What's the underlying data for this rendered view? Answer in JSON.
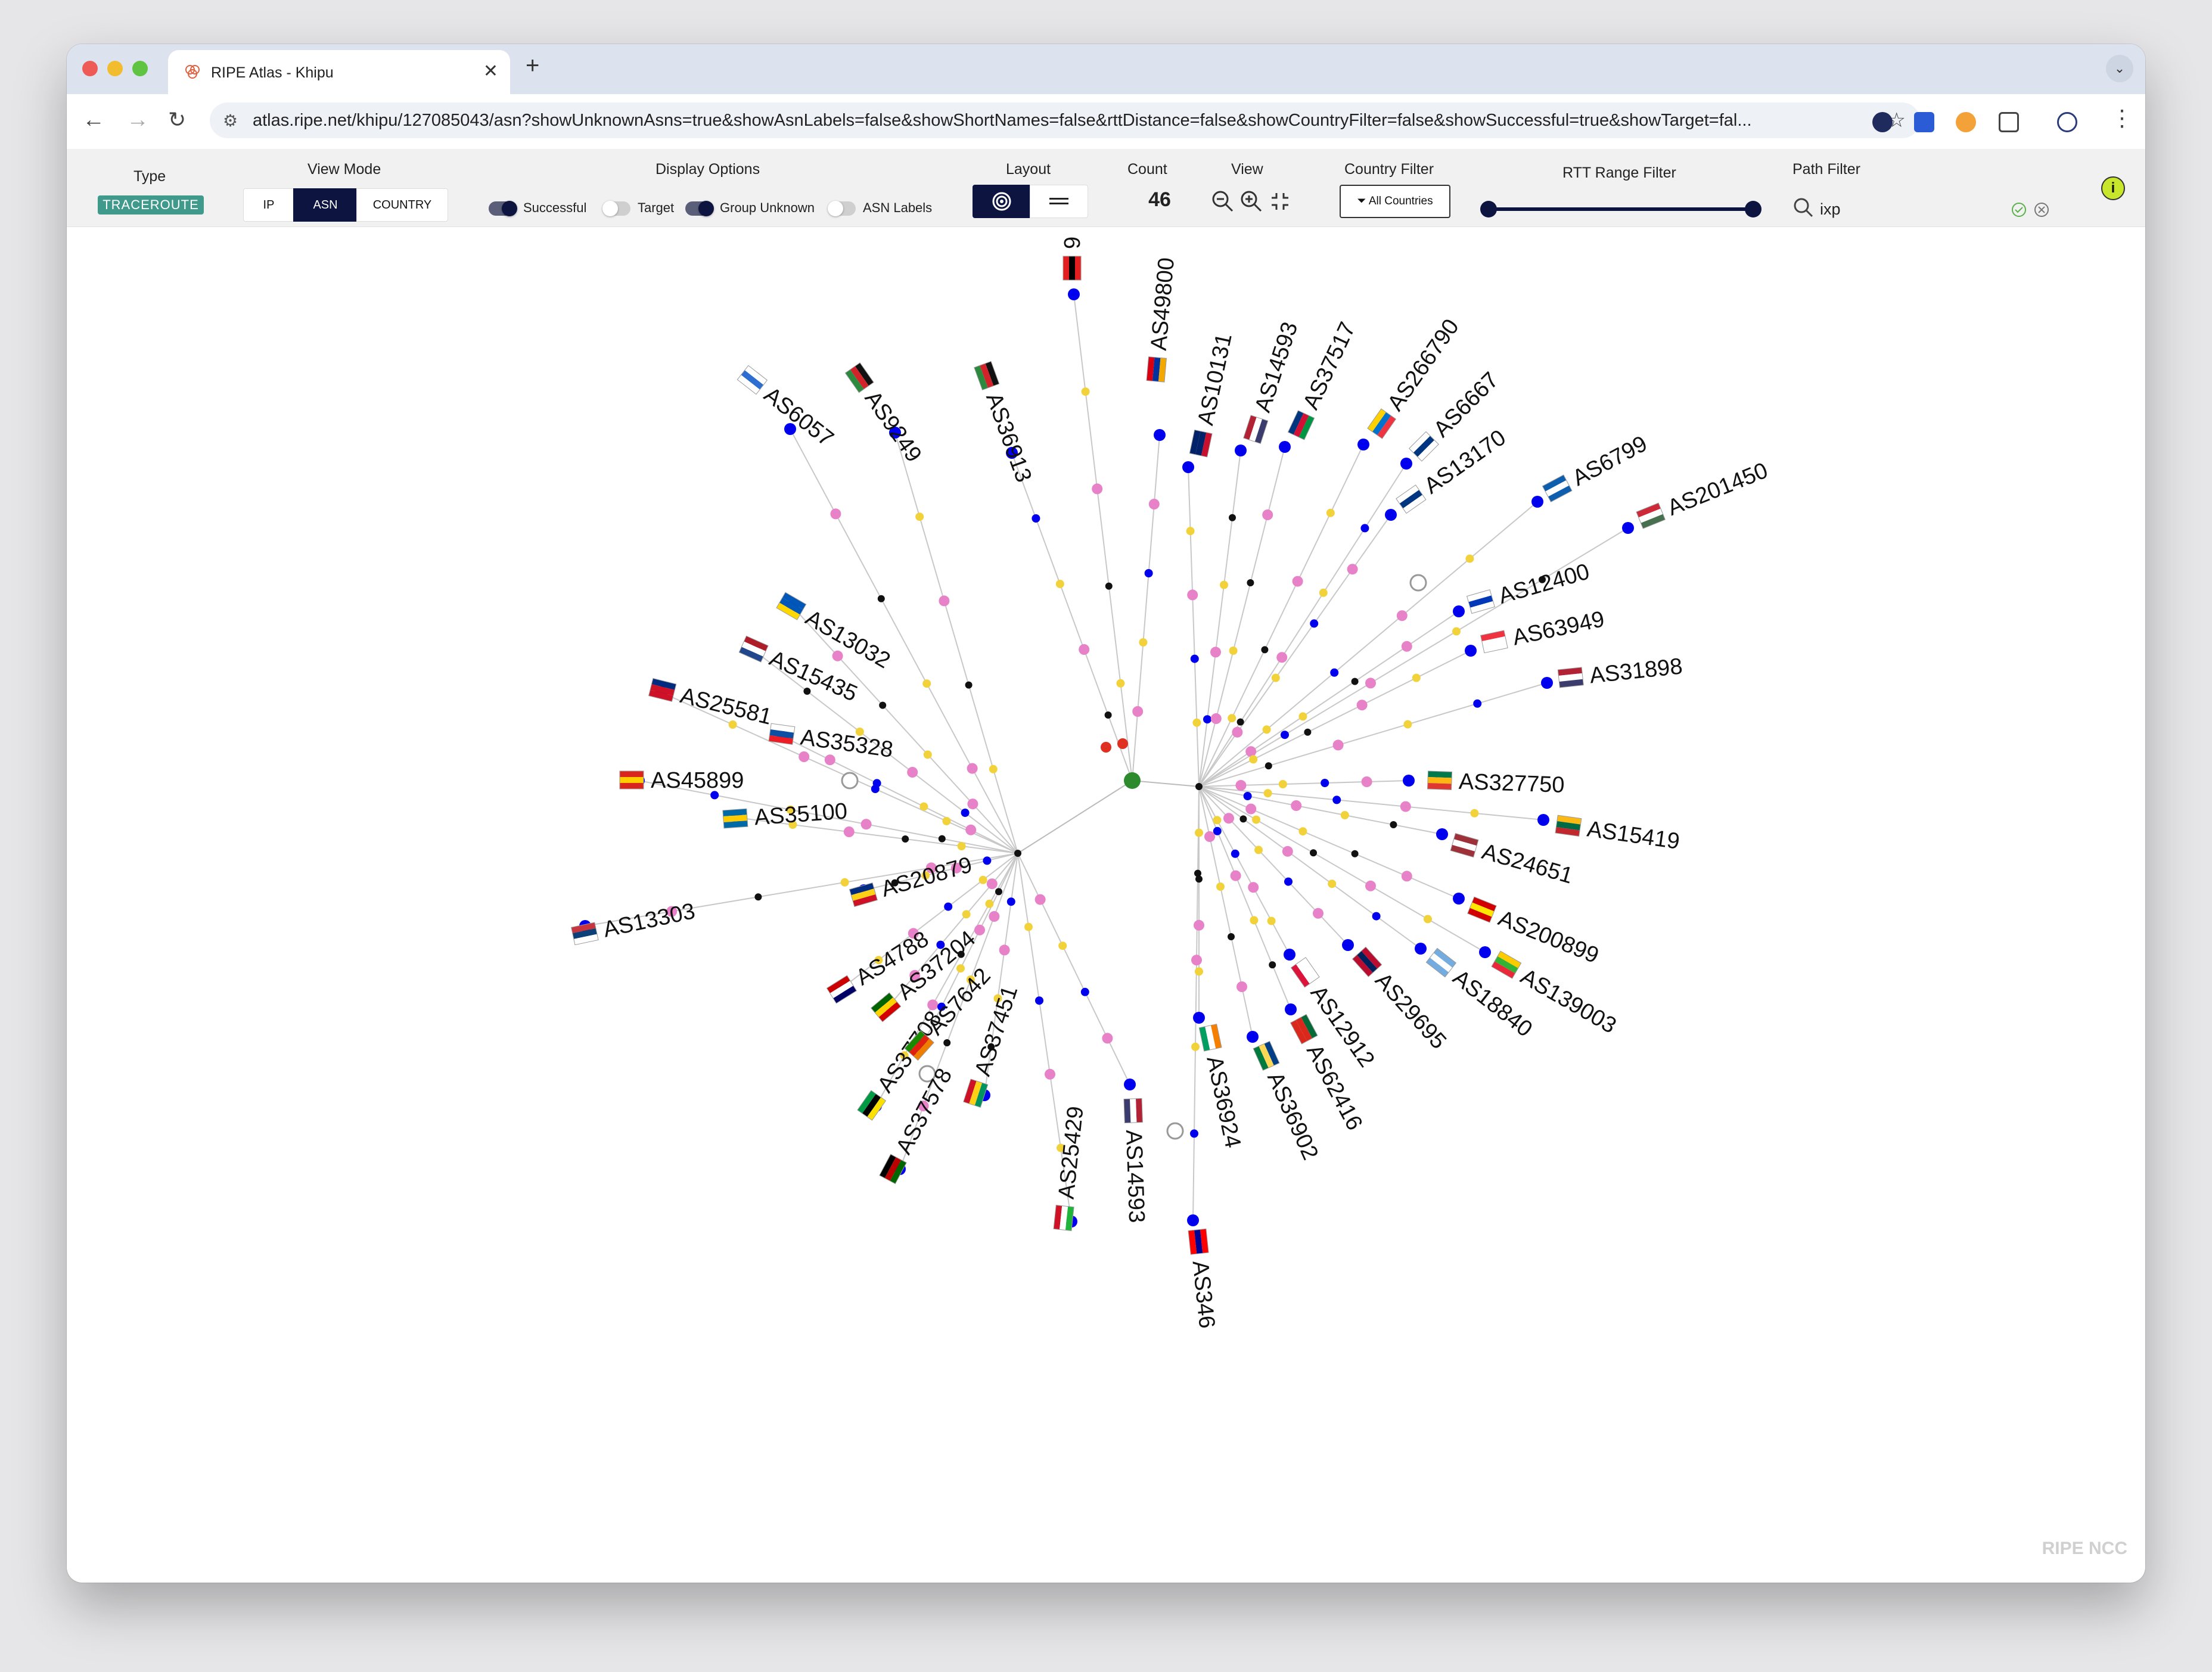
{
  "browser": {
    "tab_title": "RIPE Atlas - Khipu",
    "url": "atlas.ripe.net/khipu/127085043/asn?showUnknownAsns=true&showAsnLabels=false&showShortNames=false&rttDistance=false&showCountryFilter=false&showSuccessful=true&showTarget=fal..."
  },
  "header": {
    "type_label": "Type",
    "type_value": "TRACEROUTE",
    "view_mode_label": "View Mode",
    "view_modes": [
      "IP",
      "ASN",
      "COUNTRY"
    ],
    "active_view_mode": "ASN",
    "display_options_label": "Display Options",
    "toggles": [
      {
        "label": "Successful",
        "on": true
      },
      {
        "label": "Target",
        "on": false
      },
      {
        "label": "Group Unknown",
        "on": true
      },
      {
        "label": "ASN Labels",
        "on": false
      }
    ],
    "layout_label": "Layout",
    "count_label": "Count",
    "count_value": "46",
    "view_label": "View",
    "country_filter_label": "Country Filter",
    "country_filter_button": "All Countries",
    "rtt_label": "RTT Range Filter",
    "path_filter_label": "Path Filter",
    "path_filter_value": "ixp",
    "colors": {
      "accent": "#0d1440",
      "badge": "#3f9a8c",
      "info": "#c8e62c"
    }
  },
  "graph": {
    "colors": {
      "probe": "#0000ee",
      "hop": "#e882c8",
      "ixp": "#f2d23a",
      "unknown": "#111111",
      "origin": "#2d8a2d",
      "error": "#e03020"
    },
    "labels": [
      {
        "text": "AS6057",
        "flag": "UY"
      },
      {
        "text": "AS9249",
        "flag": "MW"
      },
      {
        "text": "AS36913",
        "flag": "MW"
      },
      {
        "text": "AS49800",
        "flag": "AM"
      },
      {
        "text": "AS10131",
        "flag": "NZ"
      },
      {
        "text": "AS14593",
        "flag": "US"
      },
      {
        "text": "AS37517",
        "flag": "NA"
      },
      {
        "text": "AS266790",
        "flag": "EC"
      },
      {
        "text": "AS6667",
        "flag": "FI"
      },
      {
        "text": "AS13170",
        "flag": "FI"
      },
      {
        "text": "AS6799",
        "flag": "GR"
      },
      {
        "text": "AS201450",
        "flag": "HU"
      },
      {
        "text": "AS12400",
        "flag": "IL"
      },
      {
        "text": "AS63949",
        "flag": "SG"
      },
      {
        "text": "AS31898",
        "flag": "US"
      },
      {
        "text": "AS327750",
        "flag": "ZA"
      },
      {
        "text": "AS15419",
        "flag": "LT"
      },
      {
        "text": "AS24651",
        "flag": "LV"
      },
      {
        "text": "AS200899",
        "flag": "MK"
      },
      {
        "text": "AS139003",
        "flag": "MM"
      },
      {
        "text": "AS18840",
        "flag": "AR"
      },
      {
        "text": "AS29695",
        "flag": "NO"
      },
      {
        "text": "AS12912",
        "flag": "PL"
      },
      {
        "text": "AS62416",
        "flag": "PT"
      },
      {
        "text": "AS36902",
        "flag": "SC"
      },
      {
        "text": "AS36924",
        "flag": "CI"
      },
      {
        "text": "AS346",
        "flag": "TW"
      },
      {
        "text": "AS14593",
        "flag": "US"
      },
      {
        "text": "AS25429",
        "flag": "BI"
      },
      {
        "text": "AS37451",
        "flag": "GN"
      },
      {
        "text": "AS37578",
        "flag": "KE"
      },
      {
        "text": "AS37708",
        "flag": "MZ"
      },
      {
        "text": "AS7642",
        "flag": "ZM"
      },
      {
        "text": "AS37204",
        "flag": "ZW"
      },
      {
        "text": "AS4788",
        "flag": "MY"
      },
      {
        "text": "AS20879",
        "flag": "RO"
      },
      {
        "text": "AS13303",
        "flag": "RS"
      },
      {
        "text": "AS35100",
        "flag": "SE"
      },
      {
        "text": "AS45899",
        "flag": "VN"
      },
      {
        "text": "AS35328",
        "flag": "SK"
      },
      {
        "text": "AS25581",
        "flag": "LI"
      },
      {
        "text": "AS15435",
        "flag": "NL"
      },
      {
        "text": "AS13032",
        "flag": "UA"
      },
      {
        "text": "9",
        "flag": "AL"
      }
    ]
  },
  "watermark": "RIPE NCC"
}
